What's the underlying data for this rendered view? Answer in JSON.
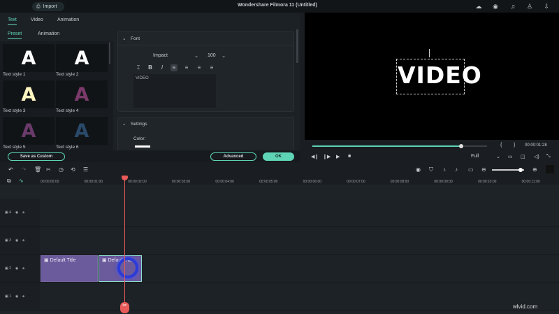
{
  "app": {
    "title": "Wondershare Filmora 11 (Untitled)",
    "import_label": "Import"
  },
  "tabs": [
    {
      "label": "Text",
      "active": true
    },
    {
      "label": "Video"
    },
    {
      "label": "Animation"
    }
  ],
  "subtabs": [
    {
      "label": "Preset",
      "active": true
    },
    {
      "label": "Animation"
    }
  ],
  "styles": [
    {
      "label": "Text style 1",
      "letter": "A",
      "color": "#ffffff"
    },
    {
      "label": "Text style 2",
      "letter": "A",
      "color": "#ffffff"
    },
    {
      "label": "Text style 3",
      "letter": "A",
      "color": "#fff6c0"
    },
    {
      "label": "Text style 4",
      "letter": "A",
      "color": "#7a3a6a"
    },
    {
      "label": "Text style 5",
      "letter": "A",
      "color": "#6a3a6a"
    },
    {
      "label": "Text style 6",
      "letter": "A",
      "color": "#2a4a6a"
    }
  ],
  "font": {
    "header": "Font",
    "family": "Impact",
    "size": "100",
    "text": "VIDEO"
  },
  "settings": {
    "header": "Settings",
    "color_label": "Color:"
  },
  "buttons": {
    "save_custom": "Save as Custom",
    "advanced": "Advanced",
    "ok": "OK"
  },
  "preview": {
    "text": "VIDEO",
    "timecode": "00:00:01:28",
    "progress": 0.85,
    "quality": "Full"
  },
  "ruler": [
    "00:00:00:00",
    "00:00:01:00",
    "00:00:02:00",
    "00:00:03:00",
    "00:00:04:00",
    "00:00:05:00",
    "00:00:06:00",
    "00:00:07:00",
    "00:00:08:00",
    "00:00:09:00",
    "00:00:10:00",
    "00:00:11:00"
  ],
  "tracks": [
    {
      "num": "4"
    },
    {
      "num": "3"
    },
    {
      "num": "2"
    },
    {
      "num": "1"
    }
  ],
  "clips": [
    {
      "label": "Default Title"
    },
    {
      "label": "Default Title"
    }
  ],
  "watermark": "wlvid.com",
  "colors": {
    "accent": "#5fd3b5",
    "clip": "#6b5a9c",
    "playhead": "#e85a5a"
  }
}
